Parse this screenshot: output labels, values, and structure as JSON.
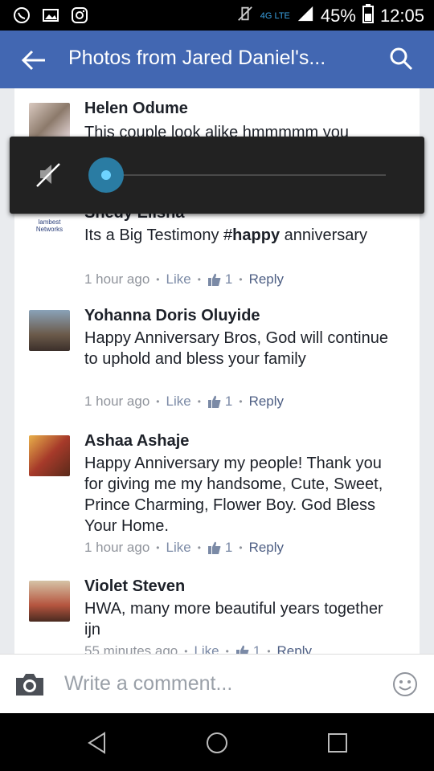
{
  "status_bar": {
    "network": "4G LTE",
    "network_sub": "LTE",
    "battery": "45%",
    "time": "12:05"
  },
  "header": {
    "title": "Photos from Jared Daniel's..."
  },
  "comments": [
    {
      "name": "Helen Odume",
      "text": "This couple look alike hmmmmm you",
      "avatar_color": "#8c7a6b"
    },
    {
      "name": "Shedy Elisha",
      "text_before": "Its a Big Testimony #",
      "text_bold": "happy",
      "text_after": " anniversary",
      "time": "1 hour ago",
      "like_label": "Like",
      "likes": "1",
      "reply_label": "Reply",
      "avatar_text": "lambest Networks"
    },
    {
      "name": "Yohanna Doris Oluyide",
      "text": "Happy Anniversary Bros, God will continue to uphold and bless your family",
      "time": "1 hour ago",
      "like_label": "Like",
      "likes": "1",
      "reply_label": "Reply",
      "avatar_color": "#6b5a4a"
    },
    {
      "name": "Ashaa Ashaje",
      "text": "Happy Anniversary my people! Thank you for giving me my handsome, Cute, Sweet, Prince Charming, Flower Boy. God Bless Your Home.",
      "time": "1 hour ago",
      "like_label": "Like",
      "likes": "1",
      "reply_label": "Reply",
      "avatar_color": "#a63a2a"
    },
    {
      "name": "Violet Steven",
      "text": "HWA, many more beautiful years together ijn",
      "time": "55 minutes ago",
      "like_label": "Like",
      "likes": "1",
      "reply_label": "Reply",
      "avatar_color": "#b5553f"
    }
  ],
  "composer": {
    "placeholder": "Write a comment..."
  },
  "volume": {
    "level": 0
  },
  "icons": {
    "whatsapp": "whatsapp-icon",
    "gallery": "gallery-icon",
    "instagram": "instagram-icon",
    "mute": "mute-icon",
    "back": "back-arrow-icon",
    "search": "search-icon",
    "camera": "camera-icon",
    "smile": "smiley-icon"
  },
  "colors": {
    "accent": "#4267b2",
    "link": "#4e5f84"
  }
}
